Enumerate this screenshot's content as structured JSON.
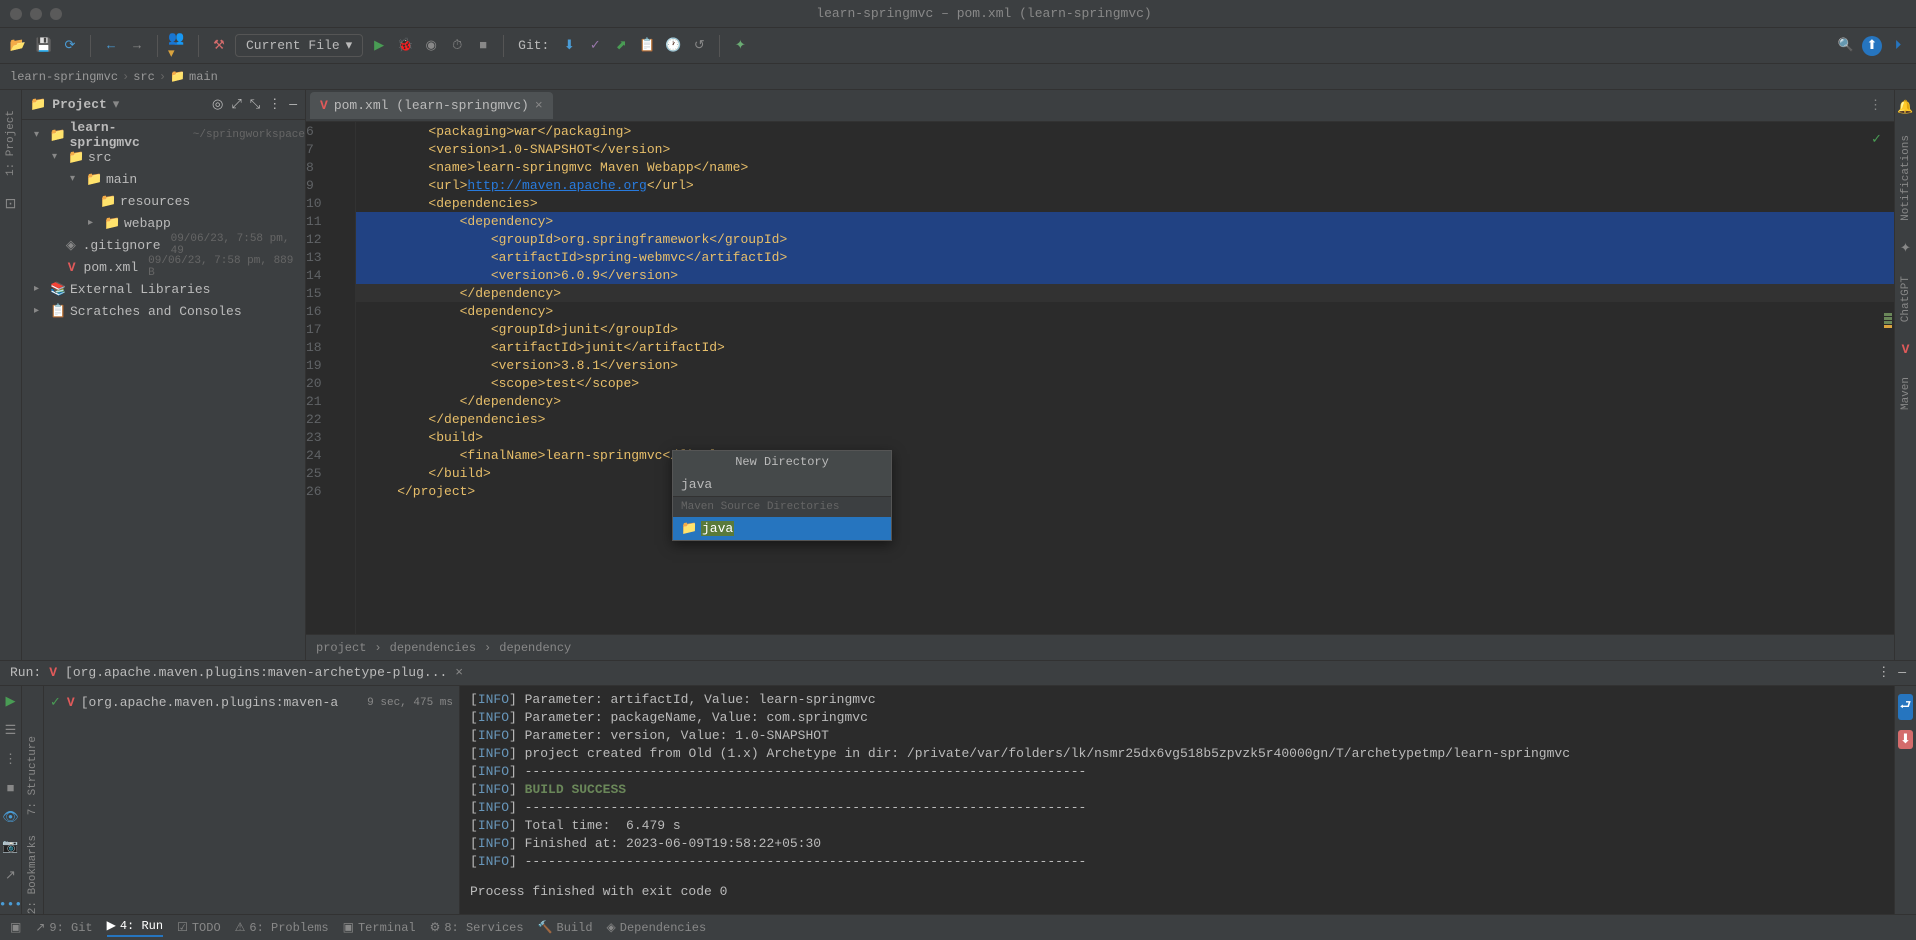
{
  "titlebar": "learn-springmvc – pom.xml (learn-springmvc)",
  "toolbar": {
    "run_config": "Current File",
    "git": "Git:"
  },
  "breadcrumb": {
    "p1": "learn-springmvc",
    "p2": "src",
    "p3": "main"
  },
  "proj": {
    "title": "Project",
    "root": "learn-springmvc",
    "root_meta": "~/springworkspace",
    "src": "src",
    "main": "main",
    "resources": "resources",
    "webapp": "webapp",
    "gitignore": ".gitignore",
    "gitignore_meta": "09/06/23, 7:58 pm, 49",
    "pom": "pom.xml",
    "pom_meta": "09/06/23, 7:58 pm, 889 B",
    "ext": "External Libraries",
    "scratches": "Scratches and Consoles"
  },
  "tab": {
    "name": "pom.xml (learn-springmvc)"
  },
  "lines": {
    "start": 6,
    "l6": "        <packaging>war</packaging>",
    "l7": "        <version>1.0-SNAPSHOT</version>",
    "l8": "        <name>learn-springmvc Maven Webapp</name>",
    "l9_a": "        <url>",
    "l9_b": "http://maven.apache.org",
    "l9_c": "</url>",
    "l10": "        <dependencies>",
    "l11": "            <dependency>",
    "l12": "                <groupId>org.springframework</groupId>",
    "l13": "                <artifactId>spring-webmvc</artifactId>",
    "l14": "                <version>6.0.9</version>",
    "l15": "            </dependency>",
    "l16": "            <dependency>",
    "l17": "                <groupId>junit</groupId>",
    "l18": "                <artifactId>junit</artifactId>",
    "l19": "                <version>3.8.1</version>",
    "l20": "                <scope>test</scope>",
    "l21": "            </dependency>",
    "l22": "        </dependencies>",
    "l23": "        <build>",
    "l24": "            <finalName>learn-springmvc</finalName>",
    "l25": "        </build>",
    "l26": "    </project>"
  },
  "code_crumb": {
    "p1": "project",
    "p2": "dependencies",
    "p3": "dependency"
  },
  "run": {
    "label": "Run:",
    "tab": "[org.apache.maven.plugins:maven-archetype-plug...",
    "tree_item": "[org.apache.maven.plugins:maven-a",
    "tree_meta": "9 sec, 475 ms"
  },
  "console": {
    "c0": "] Parameter: artifactId, Value: learn-springmvc",
    "c1": "] Parameter: packageName, Value: com.springmvc",
    "c2": "] Parameter: version, Value: 1.0-SNAPSHOT",
    "c3": "] project created from Old (1.x) Archetype in dir: /private/var/folders/lk/nsmr25dx6vg518b5zpvzk5r40000gn/T/archetypetmp/learn-springmvc",
    "dash": "] ------------------------------------------------------------------------",
    "build": "BUILD SUCCESS",
    "total": "] Total time:  6.479 s",
    "fin": "] Finished at: 2023-06-09T19:58:22+05:30",
    "exit": "Process finished with exit code 0",
    "info": "INFO"
  },
  "status": {
    "git": "9: Git",
    "run": "4: Run",
    "todo": "TODO",
    "problems": "6: Problems",
    "terminal": "Terminal",
    "services": "8: Services",
    "build": "Build",
    "deps": "Dependencies"
  },
  "sidebars": {
    "project": "1: Project",
    "structure": "7: Structure",
    "bookmarks": "2: Bookmarks",
    "notifications": "Notifications",
    "chatgpt": "ChatGPT",
    "maven": "Maven"
  },
  "popup": {
    "title": "New Directory",
    "input": "java",
    "section": "Maven Source Directories",
    "item": "java"
  }
}
